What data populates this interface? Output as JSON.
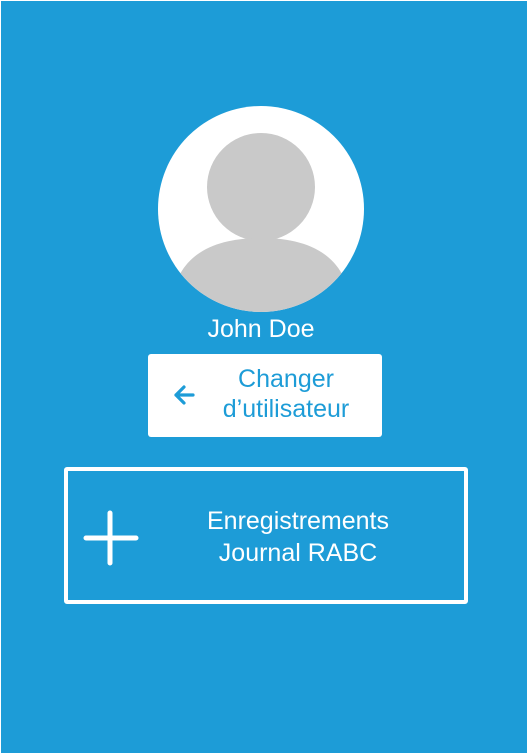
{
  "user": {
    "name": "John Doe",
    "avatar_icon": "person-silhouette-icon"
  },
  "switch_user": {
    "label": "Changer d’utilisateur",
    "icon": "arrow-left-icon"
  },
  "journal_button": {
    "line1": "Enregistrements",
    "line2": "Journal RABC",
    "icon": "plus-icon"
  },
  "colors": {
    "background": "#1d9cd7",
    "foreground": "#ffffff",
    "avatar_fill": "#c9c9c9"
  }
}
